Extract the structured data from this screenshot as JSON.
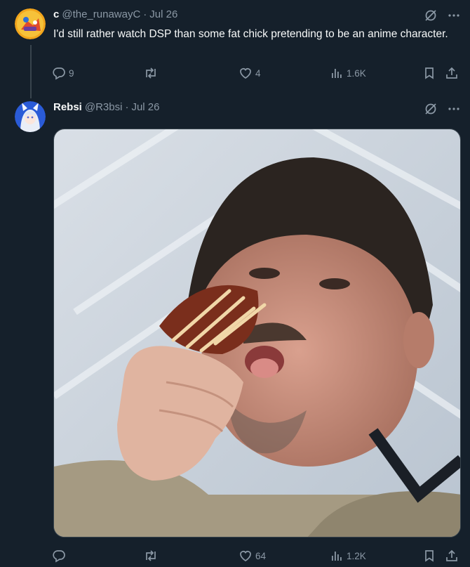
{
  "tweet1": {
    "name": "c",
    "handle": "@the_runawayC",
    "separator": "·",
    "date": "Jul 26",
    "text": "I'd still rather watch DSP than some fat chick pretending to be an anime character.",
    "stats": {
      "replies": "9",
      "reposts": "",
      "likes": "4",
      "views": "1.6K"
    }
  },
  "tweet2": {
    "name": "Rebsi",
    "handle": "@R3bsi",
    "separator": "·",
    "date": "Jul 26",
    "stats": {
      "replies": "",
      "reposts": "",
      "likes": "64",
      "views": "1.2K"
    }
  },
  "colors": {
    "background": "#15202b",
    "muted": "#8b98a5",
    "text": "#f7f9f9",
    "border": "#38444d"
  },
  "icons": [
    "grok-icon",
    "more-icon",
    "reply-icon",
    "repost-icon",
    "like-icon",
    "views-icon",
    "bookmark-icon",
    "share-icon"
  ]
}
